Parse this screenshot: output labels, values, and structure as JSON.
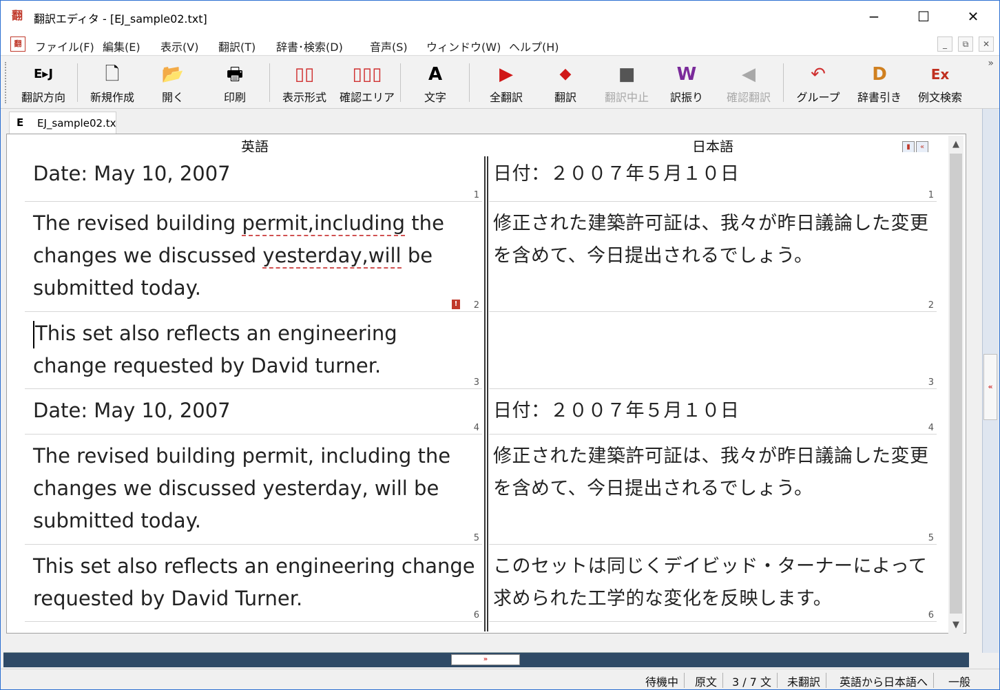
{
  "window": {
    "title": "翻訳エディタ - [EJ_sample02.txt]",
    "app_icon": "翻",
    "minimize": "−",
    "maximize": "☐",
    "close": "✕"
  },
  "menu": {
    "icon": "翻",
    "items": [
      "ファイル(F)",
      "編集(E)",
      "表示(V)",
      "翻訳(T)",
      "辞書･検索(D)",
      "音声(S)",
      "ウィンドウ(W)",
      "ヘルプ(H)"
    ],
    "mdi": [
      "_",
      "⧉",
      "✕"
    ]
  },
  "toolbar": {
    "items": [
      {
        "label": "翻訳方向",
        "icon": "E▸J"
      },
      {
        "label": "新規作成",
        "icon": "🗋"
      },
      {
        "label": "開く",
        "icon": "📂"
      },
      {
        "label": "印刷",
        "icon": "🖶"
      },
      {
        "label": "表示形式",
        "icon": "▯▯"
      },
      {
        "label": "確認エリア",
        "icon": "▯▯▯"
      },
      {
        "label": "文字",
        "icon": "A"
      },
      {
        "label": "全翻訳",
        "icon": "▶"
      },
      {
        "label": "翻訳",
        "icon": "◆"
      },
      {
        "label": "翻訳中止",
        "icon": "■"
      },
      {
        "label": "訳振り",
        "icon": "W"
      },
      {
        "label": "確認翻訳",
        "icon": "◀"
      },
      {
        "label": "グループ",
        "icon": "↶"
      },
      {
        "label": "辞書引き",
        "icon": "D"
      },
      {
        "label": "例文検索",
        "icon": "Ex"
      }
    ],
    "more": "»"
  },
  "document_tab": {
    "badge": "E",
    "name": "EJ_sample02.txt"
  },
  "editor": {
    "source_header": "英語",
    "target_header": "日本語",
    "segments": [
      {
        "num": "1",
        "source": "Date: May 10, 2007",
        "target": "日付：２００７年５月１０日"
      },
      {
        "num": "2",
        "source_parts": [
          "The revised building ",
          "permit,including",
          " the changes we discussed ",
          "yesterday,will",
          " be submitted today."
        ],
        "target": "修正された建築許可証は、我々が昨日議論した変更を含めて、今日提出されるでしょう。",
        "warning": "!"
      },
      {
        "num": "3",
        "source": "This set also reflects an engineering change requested by David turner.",
        "target": ""
      },
      {
        "num": "4",
        "source": "Date: May 10, 2007",
        "target": "日付：２００７年５月１０日"
      },
      {
        "num": "5",
        "source": "The revised building permit, including the changes we discussed yesterday, will be submitted today.",
        "target": "修正された建築許可証は、我々が昨日議論した変更を含めて、今日提出されるでしょう。"
      },
      {
        "num": "6",
        "source": "This set also reflects an engineering change requested by David Turner.",
        "target": "このセットは同じくデイビッド・ターナーによって求められた工学的な変化を反映します。"
      }
    ]
  },
  "scroll": {
    "up": "▲",
    "down": "▼"
  },
  "sidebar_toggle": "«",
  "splitter_grip": "»",
  "status": {
    "state": "待機中",
    "mode": "原文",
    "position": "3 / 7 文",
    "translation_status": "未翻訳",
    "direction": "英語から日本語へ",
    "field": "一般"
  },
  "colors": {
    "accent_red": "#c0392b",
    "splitter": "#2f4a66",
    "window_border": "#2b6fd1"
  }
}
